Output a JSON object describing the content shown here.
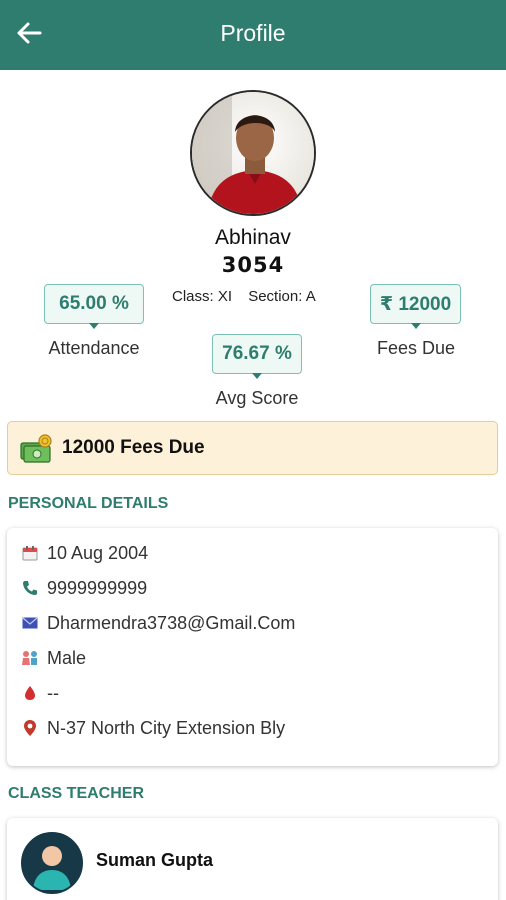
{
  "header": {
    "title": "Profile",
    "bg_color": "#2e7d6f"
  },
  "student": {
    "name": "Abhinav",
    "roll": "3054",
    "class_text": "Class: XI",
    "section_text": "Section: A"
  },
  "stats": {
    "attendance_value": "65.00 %",
    "attendance_label": "Attendance",
    "fees_value": "₹ 12000",
    "fees_label": "Fees Due",
    "avg_value": "76.67 %",
    "avg_label": "Avg Score"
  },
  "fees_banner": {
    "text": "12000 Fees Due",
    "icon": "money-icon"
  },
  "personal_details": {
    "title": "PERSONAL DETAILS",
    "dob": "10 Aug 2004",
    "phone": "9999999999",
    "email": "Dharmendra3738@Gmail.Com",
    "gender": "Male",
    "blood_group": "--",
    "address": "N-37 North City Extension Bly"
  },
  "class_teacher": {
    "title": "CLASS TEACHER",
    "name": "Suman Gupta"
  }
}
